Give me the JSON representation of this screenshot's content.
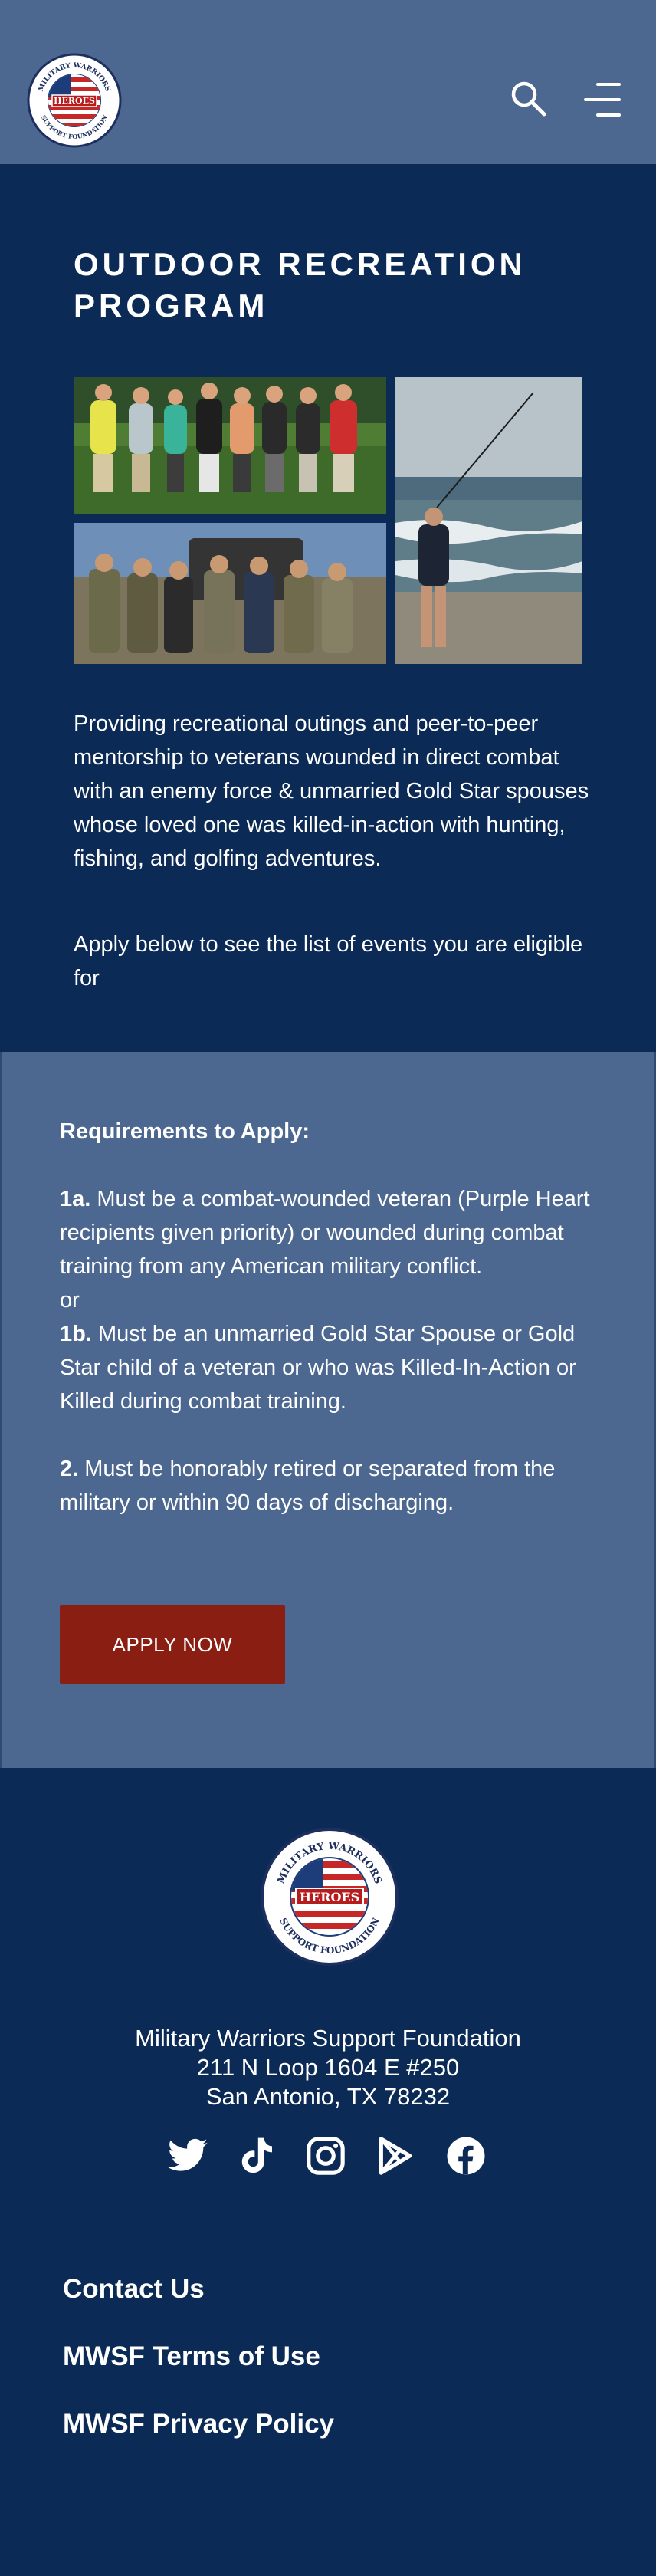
{
  "header": {
    "logo": {
      "top_text": "MILITARY WARRIORS",
      "center_text": "HEROES",
      "bottom_text": "SUPPORT FOUNDATION"
    },
    "search_icon": "search-icon",
    "menu_icon": "hamburger-menu-icon"
  },
  "hero": {
    "title": "OUTDOOR RECREATION PROGRAM",
    "photos": [
      "golf-group-photo",
      "hunting-group-photo",
      "fishing-photo"
    ],
    "description": "Providing recreational outings and peer-to-peer mentorship to veterans wounded in direct combat with an enemy force & unmarried Gold Star spouses whose loved one was killed-in-action with hunting, fishing, and golfing adventures.",
    "apply_note": "Apply below to see the list of events you are eligible for"
  },
  "requirements": {
    "heading": "Requirements to Apply:",
    "item_1a_label": "1a.",
    "item_1a_text": " Must be a combat-wounded veteran (Purple Heart recipients given priority) or wounded during combat training from any American military conflict.",
    "or_text": "or",
    "item_1b_label": "1b.",
    "item_1b_text": " Must be an unmarried Gold Star Spouse or Gold Star child of a veteran or who was Killed-In-Action or Killed during combat training.",
    "item_2_label": "2.",
    "item_2_text": " Must be honorably retired or separated from the military or within 90 days of discharging.",
    "apply_button": "APPLY NOW"
  },
  "footer": {
    "logo": {
      "top_text": "MILITARY WARRIORS",
      "center_text": "HEROES",
      "bottom_text": "SUPPORT FOUNDATION"
    },
    "org_name": "Military Warriors Support Foundation",
    "address_line1": "211 N Loop 1604 E #250",
    "address_line2": "San Antonio, TX 78232",
    "socials": [
      "twitter-icon",
      "tiktok-icon",
      "instagram-icon",
      "google-play-icon",
      "facebook-icon"
    ],
    "links": [
      "Contact Us",
      "MWSF Terms of Use",
      "MWSF Privacy Policy"
    ]
  },
  "colors": {
    "navy": "#0b2a55",
    "slate_blue": "#4c6891",
    "button_red": "#8b1e12",
    "white": "#ffffff"
  }
}
